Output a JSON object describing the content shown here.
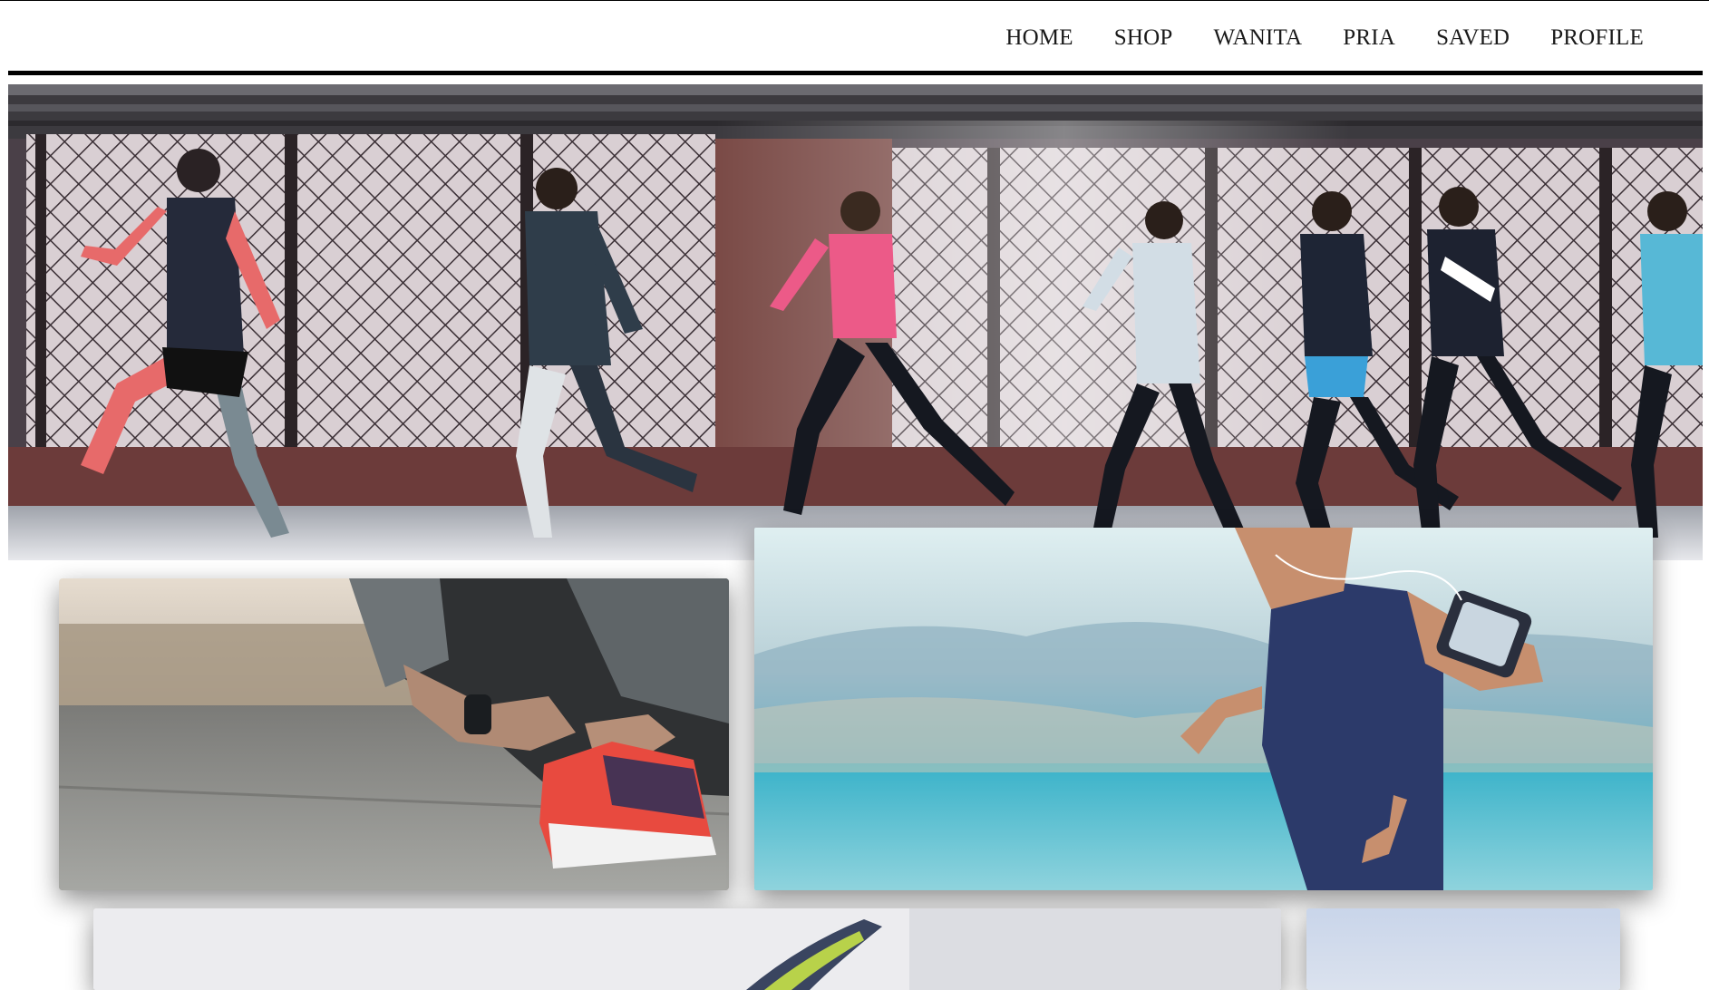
{
  "nav": {
    "items": [
      {
        "label": "HOME"
      },
      {
        "label": "SHOP"
      },
      {
        "label": "WANITA"
      },
      {
        "label": "PRIA"
      },
      {
        "label": "SAVED"
      },
      {
        "label": "PROFILE"
      }
    ]
  },
  "colors": {
    "text": "#1a1a1a",
    "rule": "#000000",
    "background": "#ffffff"
  },
  "images": {
    "hero": "group-of-runners-photo",
    "shoe": "tying-running-shoe-photo",
    "runner": "runner-with-armband-photo",
    "sneaker": "sneaker-photo",
    "small": "product-photo"
  }
}
